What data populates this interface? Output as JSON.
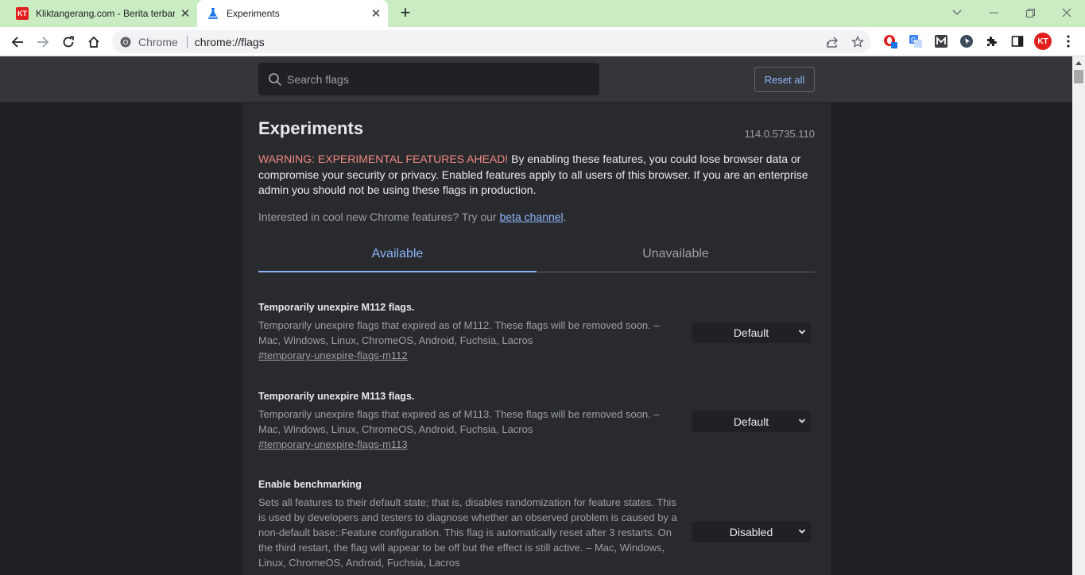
{
  "browser": {
    "tabs": [
      {
        "title": "Kliktangerang.com - Berita terbaru",
        "favicon_text": "KT"
      },
      {
        "title": "Experiments"
      }
    ],
    "omnibox": {
      "chip_label": "Chrome",
      "url": "chrome://flags"
    },
    "profile_initials": "KT"
  },
  "flags_page": {
    "search_placeholder": "Search flags",
    "reset_label": "Reset all",
    "title": "Experiments",
    "version": "114.0.5735.110",
    "warning_strong": "WARNING: EXPERIMENTAL FEATURES AHEAD!",
    "warning_text": " By enabling these features, you could lose browser data or compromise your security or privacy. Enabled features apply to all users of this browser. If you are an enterprise admin you should not be using these flags in production.",
    "interested_prefix": "Interested in cool new Chrome features? Try our ",
    "interested_link": "beta channel",
    "interested_suffix": ".",
    "tabs": [
      {
        "label": "Available"
      },
      {
        "label": "Unavailable"
      }
    ],
    "flags": [
      {
        "name": "Temporarily unexpire M112 flags.",
        "description": "Temporarily unexpire flags that expired as of M112. These flags will be removed soon. – Mac, Windows, Linux, ChromeOS, Android, Fuchsia, Lacros",
        "link": "#temporary-unexpire-flags-m112",
        "value": "Default"
      },
      {
        "name": "Temporarily unexpire M113 flags.",
        "description": "Temporarily unexpire flags that expired as of M113. These flags will be removed soon. – Mac, Windows, Linux, ChromeOS, Android, Fuchsia, Lacros",
        "link": "#temporary-unexpire-flags-m113",
        "value": "Default"
      },
      {
        "name": "Enable benchmarking",
        "description": "Sets all features to their default state; that is, disables randomization for feature states. This is used by developers and testers to diagnose whether an observed problem is caused by a non-default base::Feature configuration. This flag is automatically reset after 3 restarts. On the third restart, the flag will appear to be off but the effect is still active. – Mac, Windows, Linux, ChromeOS, Android, Fuchsia, Lacros",
        "value": "Disabled"
      }
    ]
  }
}
